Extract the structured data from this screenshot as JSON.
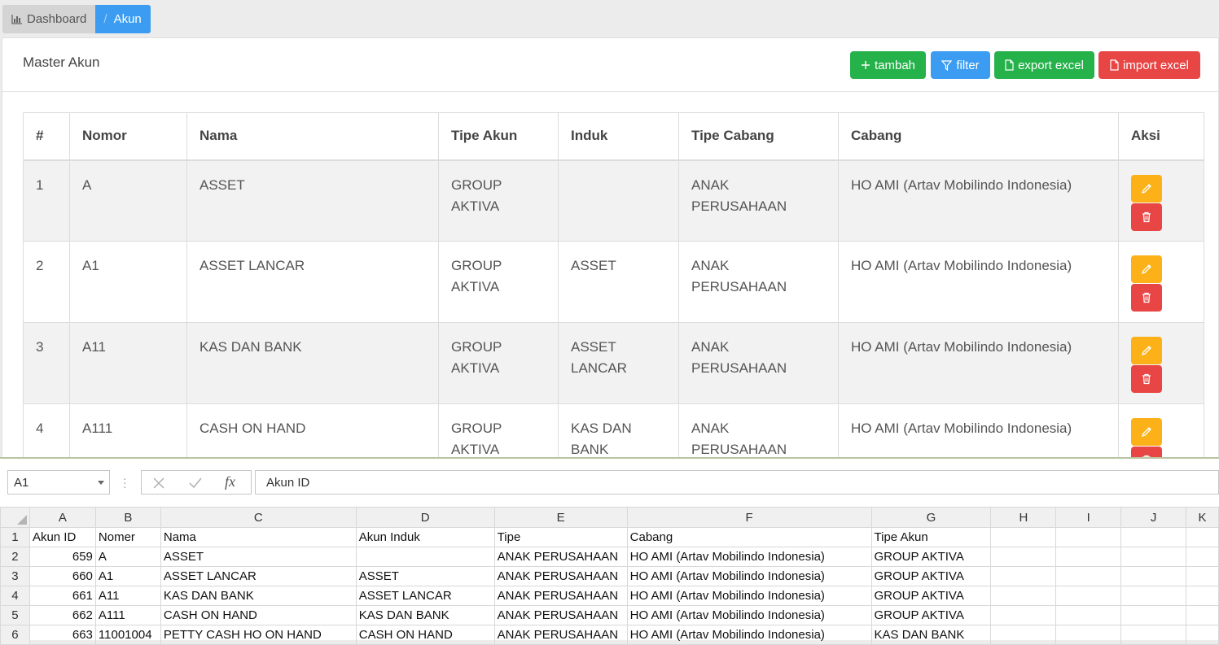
{
  "breadcrumb": {
    "dashboard": "Dashboard",
    "separator": "/",
    "current": "Akun"
  },
  "card": {
    "title": "Master Akun",
    "buttons": {
      "add": "tambah",
      "filter": "filter",
      "export": "export excel",
      "import": "import excel"
    }
  },
  "table": {
    "headers": [
      "#",
      "Nomor",
      "Nama",
      "Tipe Akun",
      "Induk",
      "Tipe Cabang",
      "Cabang",
      "Aksi"
    ],
    "rows": [
      {
        "no": "1",
        "nomor": "A",
        "nama": "ASSET",
        "tipe_akun": "GROUP AKTIVA",
        "induk": "",
        "tipe_cabang": "ANAK PERUSAHAAN",
        "cabang": "HO AMI (Artav Mobilindo Indonesia)"
      },
      {
        "no": "2",
        "nomor": "A1",
        "nama": "ASSET LANCAR",
        "tipe_akun": "GROUP AKTIVA",
        "induk": "ASSET",
        "tipe_cabang": "ANAK PERUSAHAAN",
        "cabang": "HO AMI (Artav Mobilindo Indonesia)"
      },
      {
        "no": "3",
        "nomor": "A11",
        "nama": "KAS DAN BANK",
        "tipe_akun": "GROUP AKTIVA",
        "induk": "ASSET LANCAR",
        "tipe_cabang": "ANAK PERUSAHAAN",
        "cabang": "HO AMI (Artav Mobilindo Indonesia)"
      },
      {
        "no": "4",
        "nomor": "A111",
        "nama": "CASH ON HAND",
        "tipe_akun": "GROUP AKTIVA",
        "induk": "KAS DAN BANK",
        "tipe_cabang": "ANAK PERUSAHAAN",
        "cabang": "HO AMI (Artav Mobilindo Indonesia)"
      }
    ]
  },
  "spreadsheet": {
    "name_box": "A1",
    "formula": "Akun ID",
    "fx_label": "fx",
    "columns": [
      "A",
      "B",
      "C",
      "D",
      "E",
      "F",
      "G",
      "H",
      "I",
      "J",
      "K"
    ],
    "row_numbers": [
      "1",
      "2",
      "3",
      "4",
      "5",
      "6"
    ],
    "rows": [
      [
        "Akun ID",
        "Nomer",
        "Nama",
        "Akun Induk",
        "Tipe",
        "Cabang",
        "Tipe Akun"
      ],
      [
        "659",
        "A",
        "ASSET",
        "",
        "ANAK PERUSAHAAN",
        "HO AMI (Artav Mobilindo Indonesia)",
        "GROUP AKTIVA"
      ],
      [
        "660",
        "A1",
        "ASSET LANCAR",
        "ASSET",
        "ANAK PERUSAHAAN",
        "HO AMI (Artav Mobilindo Indonesia)",
        "GROUP AKTIVA"
      ],
      [
        "661",
        "A11",
        "KAS DAN BANK",
        "ASSET LANCAR",
        "ANAK PERUSAHAAN",
        "HO AMI (Artav Mobilindo Indonesia)",
        "GROUP AKTIVA"
      ],
      [
        "662",
        "A111",
        "CASH ON HAND",
        "KAS DAN BANK",
        "ANAK PERUSAHAAN",
        "HO AMI (Artav Mobilindo Indonesia)",
        "GROUP AKTIVA"
      ],
      [
        "663",
        "11001004",
        "PETTY CASH HO ON HAND",
        "CASH ON HAND",
        "ANAK PERUSAHAAN",
        "HO AMI (Artav Mobilindo Indonesia)",
        "KAS DAN BANK"
      ]
    ]
  },
  "colors": {
    "green": "#26b24b",
    "blue": "#3b9cf2",
    "red": "#e84545",
    "yellow": "#fbb117"
  },
  "icons": {
    "dashboard": "bar-chart-icon",
    "add": "plus-icon",
    "filter": "funnel-icon",
    "export": "file-icon",
    "import": "file-icon",
    "edit": "pencil-icon",
    "delete": "trash-icon"
  }
}
